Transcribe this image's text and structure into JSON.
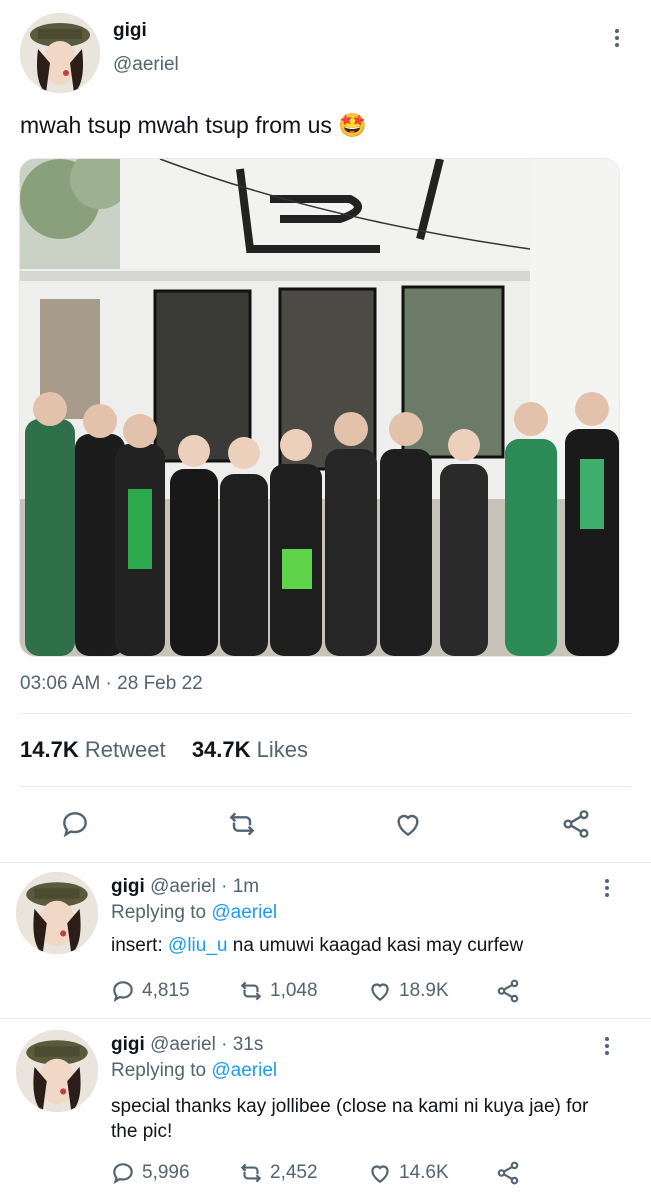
{
  "tweet": {
    "author_name": "gigi",
    "author_handle": "@aeriel",
    "text": "mwah tsup mwah tsup from us",
    "emoji": "🤩",
    "timestamp": "03:06 AM · 28 Feb 22",
    "retweet_count": "14.7K",
    "retweet_label": "Retweet",
    "likes_count": "34.7K",
    "likes_label": "Likes"
  },
  "replies": [
    {
      "author_name": "gigi",
      "author_handle": "@aeriel",
      "time": "· 1m",
      "replying_label": "Replying to",
      "replying_handle": "@aeriel",
      "text_prefix": "insert:",
      "mention": "@liu_u",
      "text_suffix": "na umuwi kaagad kasi may curfew",
      "replies": "4,815",
      "retweets": "1,048",
      "likes": "18.9K"
    },
    {
      "author_name": "gigi",
      "author_handle": "@aeriel",
      "time": "· 31s",
      "replying_label": "Replying to",
      "replying_handle": "@aeriel",
      "text": "special thanks kay jollibee (close na kami ni kuya jae) for the pic!",
      "replies": "5,996",
      "retweets": "2,452",
      "likes": "14.6K"
    }
  ],
  "colors": {
    "accent": "#1d9bf0",
    "text": "#0f1419",
    "secondary": "#536471",
    "divider": "#e6e9eb"
  }
}
